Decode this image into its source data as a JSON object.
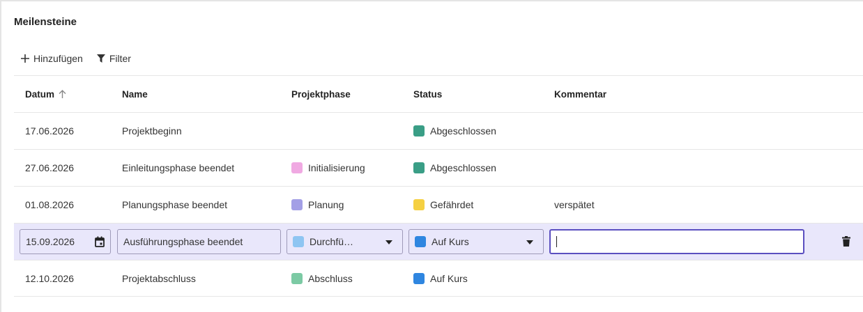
{
  "title": "Meilensteine",
  "toolbar": {
    "add_label": "Hinzufügen",
    "filter_label": "Filter"
  },
  "columns": {
    "date": "Datum",
    "name": "Name",
    "phase": "Projektphase",
    "status": "Status",
    "comment": "Kommentar",
    "sort_icon": "arrow-up-icon"
  },
  "colors": {
    "accent": "#5b4fc0",
    "edit_row_bg": "#e9e7fb",
    "abgeschlossen": "#3a9e86",
    "gefaehrdet": "#f5d042",
    "auf_kurs": "#2f86e0",
    "initialisierung": "#f0a9e2",
    "planung": "#a39fe6",
    "durchfuehrung": "#8ec5f2",
    "abschluss": "#7ccaa4"
  },
  "rows": [
    {
      "date": "17.06.2026",
      "name": "Projektbeginn",
      "phase": "",
      "status": "Abgeschlossen",
      "comment": ""
    },
    {
      "date": "27.06.2026",
      "name": "Einleitungsphase beendet",
      "phase": "Initialisierung",
      "status": "Abgeschlossen",
      "comment": ""
    },
    {
      "date": "01.08.2026",
      "name": "Planungsphase beendet",
      "phase": "Planung",
      "status": "Gefährdet",
      "comment": "verspätet"
    },
    {
      "date": "15.09.2026",
      "name": "Ausführungsphase beendet",
      "phase": "Durchfü…",
      "status": "Auf Kurs",
      "comment": ""
    },
    {
      "date": "12.10.2026",
      "name": "Projektabschluss",
      "phase": "Abschluss",
      "status": "Auf Kurs",
      "comment": ""
    }
  ]
}
